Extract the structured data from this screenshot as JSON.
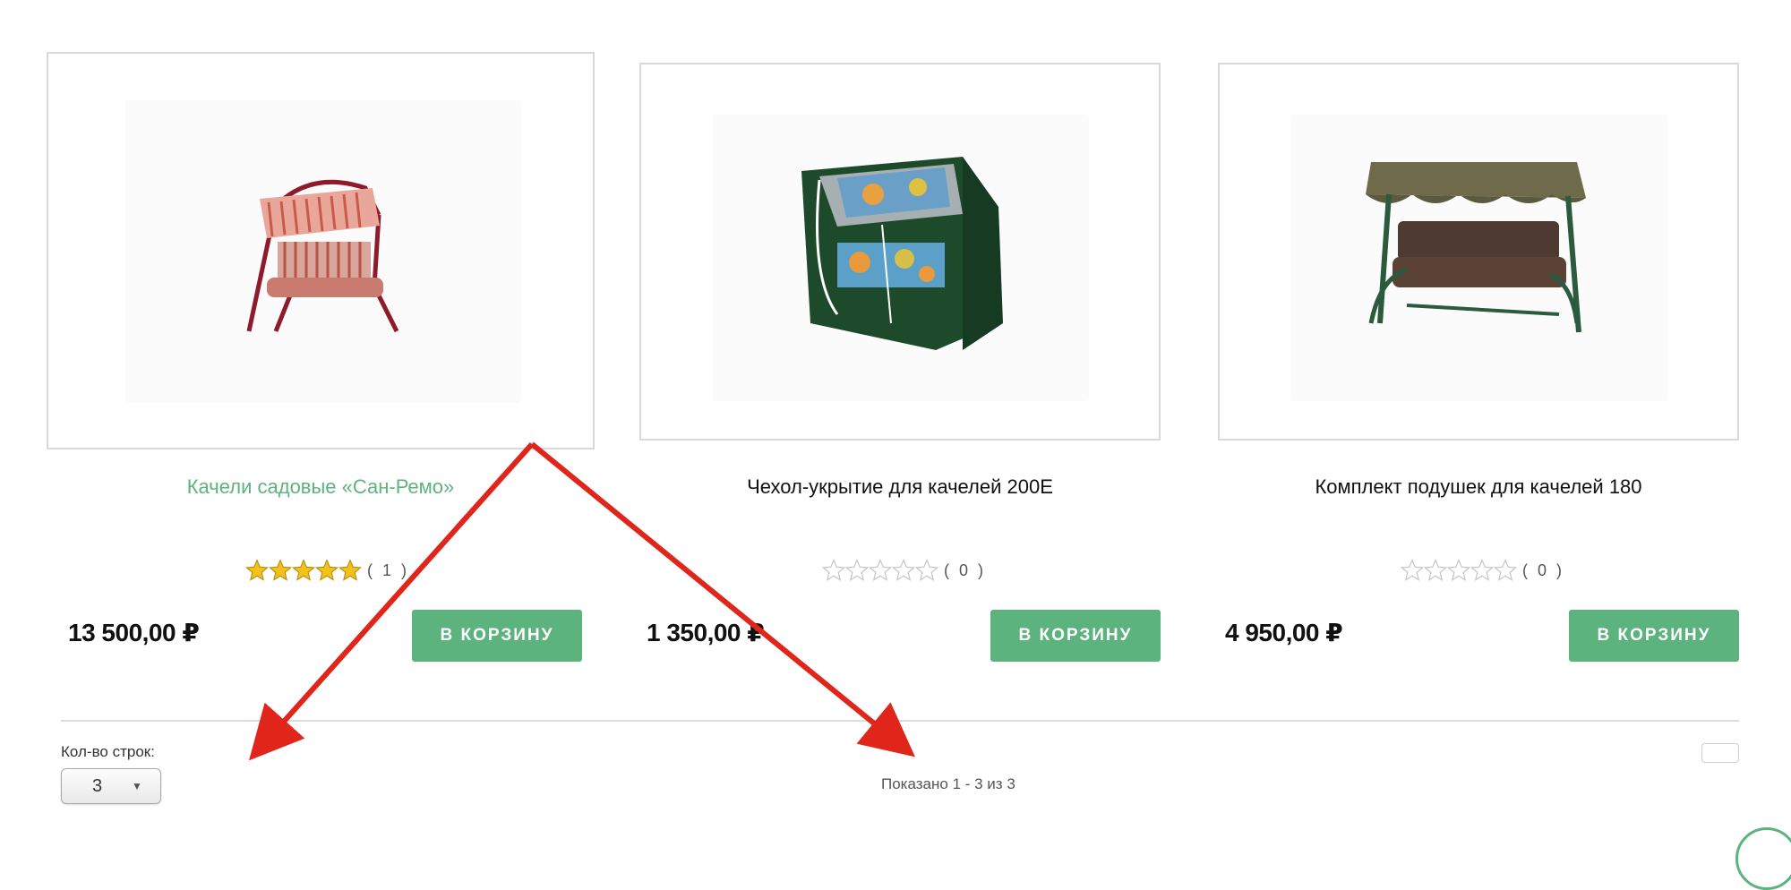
{
  "products": [
    {
      "title": "Качели садовые «Сан-Ремо»",
      "rating_stars": 5,
      "rating_count": "( 1 )",
      "price": "13 500,00 ₽",
      "button_label": "В КОРЗИНУ",
      "image_icon": "garden-swing-striped-image"
    },
    {
      "title": "Чехол-укрытие для качелей 200E",
      "rating_stars": 0,
      "rating_count": "( 0 )",
      "price": "1 350,00 ₽",
      "button_label": "В КОРЗИНУ",
      "image_icon": "swing-cover-image"
    },
    {
      "title": "Комплект подушек для качелей 180",
      "rating_stars": 0,
      "rating_count": "( 0 )",
      "price": "4 950,00 ₽",
      "button_label": "В КОРЗИНУ",
      "image_icon": "cushion-set-swing-image"
    }
  ],
  "pagination": {
    "rows_label": "Кол-во строк:",
    "rows_value": "3",
    "shown_text": "Показано 1 - 3 из 3"
  },
  "colors": {
    "accent": "#5db37e",
    "annotation_arrow": "#e0251b",
    "star_filled": "#f2c21b"
  }
}
